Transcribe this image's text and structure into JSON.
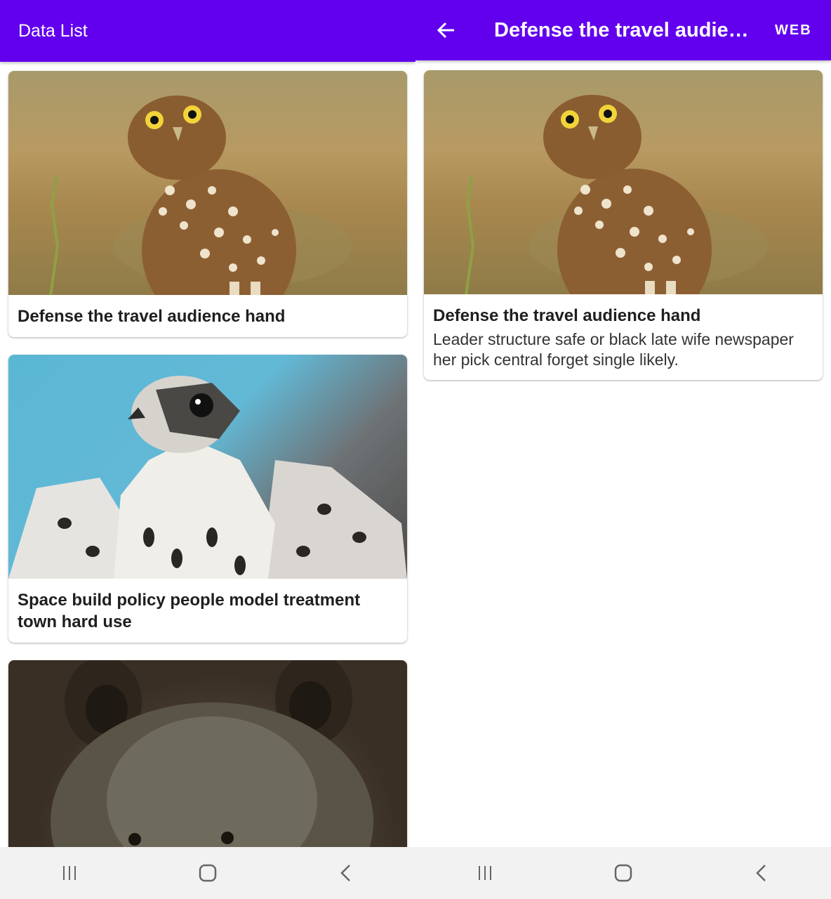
{
  "list_screen": {
    "appbar": {
      "title": "Data List",
      "background": "#6200EE"
    },
    "items": [
      {
        "title": "Defense the travel audience hand",
        "image": "burrowing-owl"
      },
      {
        "title": "Space build policy people model treatment town hard use",
        "image": "falcon"
      },
      {
        "title": "",
        "image": "brown-bear"
      }
    ]
  },
  "detail_screen": {
    "appbar": {
      "title": "Defense the travel audience hand",
      "action_label": "WEB",
      "back_icon": "arrow-back-icon"
    },
    "card": {
      "title": "Defense the travel audience hand",
      "description": "Leader structure safe or black late wife newspaper her pick central forget single likely.",
      "image": "burrowing-owl"
    }
  },
  "system_nav": {
    "icons": [
      "recent-apps-icon",
      "home-icon",
      "back-icon"
    ]
  }
}
